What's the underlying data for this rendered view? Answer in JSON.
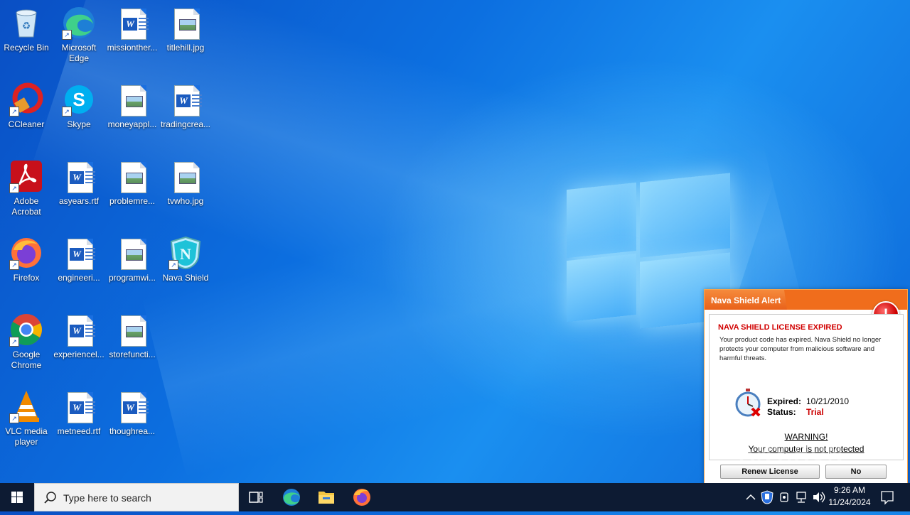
{
  "desktop": {
    "icons": [
      {
        "label": "Recycle Bin"
      },
      {
        "label": "Microsoft Edge"
      },
      {
        "label": "missionther..."
      },
      {
        "label": "titlehill.jpg"
      },
      {
        "label": "CCleaner"
      },
      {
        "label": "Skype"
      },
      {
        "label": "moneyappl..."
      },
      {
        "label": "tradingcrea..."
      },
      {
        "label": "Adobe Acrobat"
      },
      {
        "label": "asyears.rtf"
      },
      {
        "label": "problemre..."
      },
      {
        "label": "tvwho.jpg"
      },
      {
        "label": "Firefox"
      },
      {
        "label": "engineeri..."
      },
      {
        "label": "programwi..."
      },
      {
        "label": "Nava Shield"
      },
      {
        "label": "Google Chrome"
      },
      {
        "label": "experiencel..."
      },
      {
        "label": "storefuncti..."
      },
      {
        "label": "VLC media player"
      },
      {
        "label": "metneed.rtf"
      },
      {
        "label": "thoughrea..."
      }
    ]
  },
  "alert": {
    "title": "Nava Shield Alert",
    "heading": "NAVA SHIELD LICENSE EXPIRED",
    "description": "Your product code has expired. Nava Shield no longer protects your computer from malicious software and harmful threats.",
    "expired_label": "Expired:",
    "expired_value": "10/21/2010",
    "status_label": "Status:",
    "status_value": "Trial",
    "warning": "WARNING!",
    "warning_sub": "Your computer is not protected",
    "renew_button": "Renew License",
    "no_button": "No",
    "accent_color": "#f06d1c"
  },
  "watermark": "ANY.RUN",
  "taskbar": {
    "search_placeholder": "Type here to search",
    "time": "9:26 AM",
    "date": "11/24/2024"
  }
}
